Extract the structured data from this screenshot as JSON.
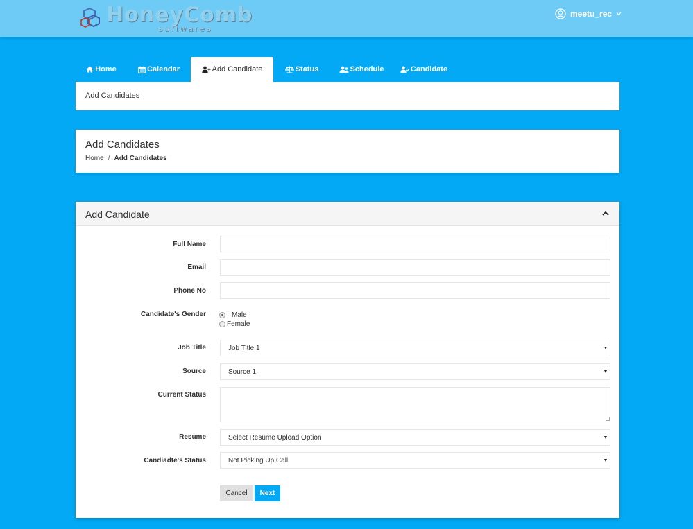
{
  "brand": {
    "name": "HoneyComb",
    "sub": "softwares"
  },
  "user": {
    "name": "meetu_rec"
  },
  "tabs": [
    {
      "label": "Home",
      "icon": "home-icon"
    },
    {
      "label": "Calendar",
      "icon": "calendar-icon"
    },
    {
      "label": "Add Candidate",
      "icon": "user-plus-icon"
    },
    {
      "label": "Status",
      "icon": "balance-scale-icon"
    },
    {
      "label": "Schedule",
      "icon": "users-icon"
    },
    {
      "label": "Candidate",
      "icon": "user-check-icon"
    }
  ],
  "strip": {
    "label": "Add Candidates"
  },
  "header": {
    "title": "Add Candidates",
    "crumb_home": "Home",
    "crumb_sep": "/",
    "crumb_current": "Add Candidates"
  },
  "form": {
    "title": "Add Candidate",
    "full_name_label": "Full Name",
    "full_name_value": "",
    "email_label": "Email",
    "email_value": "",
    "phone_label": "Phone No",
    "phone_value": "",
    "gender_label": "Candidate's Gender",
    "gender_options": [
      {
        "label": "Male",
        "checked": true
      },
      {
        "label": "Female",
        "checked": false
      }
    ],
    "job_title_label": "Job Title",
    "job_title_value": "Job Title 1",
    "source_label": "Source",
    "source_value": "Source 1",
    "current_status_label": "Current Status",
    "current_status_value": "",
    "resume_label": "Resume",
    "resume_value": "Select Resume Upload Option",
    "cand_status_label": "Candiadte's Status",
    "cand_status_value": "Not Picking Up Call",
    "cancel_label": "Cancel",
    "next_label": "Next"
  },
  "colors": {
    "background": "#03a9f4",
    "topbar": "#6ecbf6",
    "accent": "#03a9f4"
  }
}
